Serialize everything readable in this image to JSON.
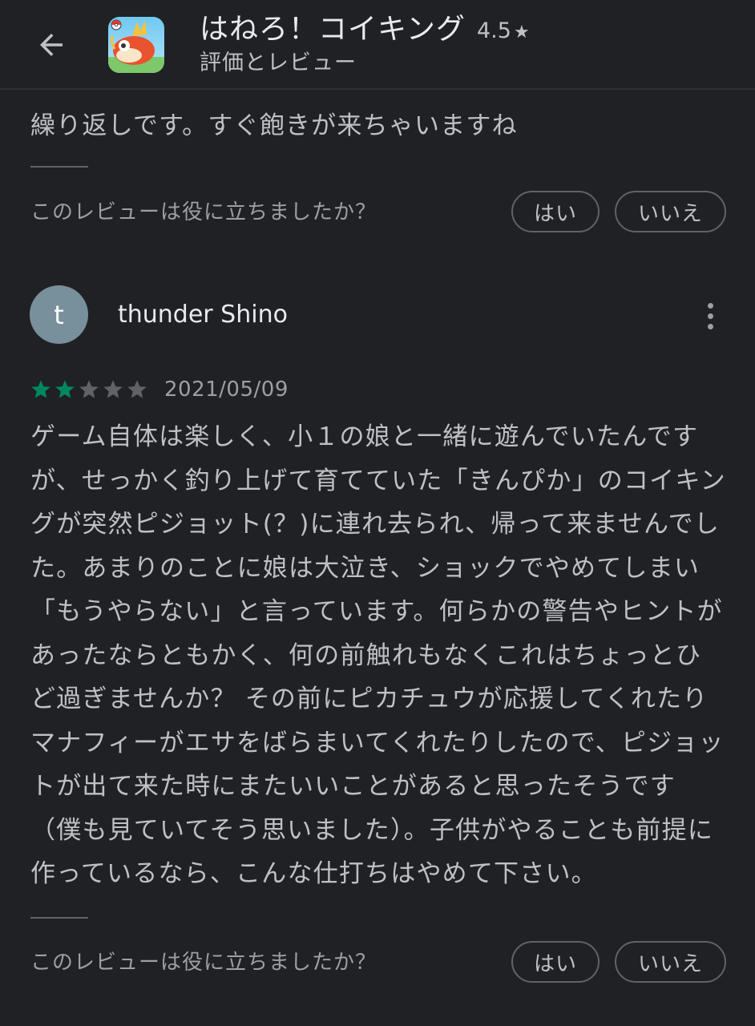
{
  "header": {
    "app_title": "はねろ！コイキング",
    "rating_value": "4.5",
    "rating_star": "★",
    "subtitle": "評価とレビュー",
    "back_icon": "arrow-back-icon"
  },
  "previous_review": {
    "text_tail": "繰り返しです。すぐ飽きが来ちゃいますね",
    "helpful_question": "このレビューは役に立ちましたか？",
    "yes_label": "はい",
    "no_label": "いいえ"
  },
  "review": {
    "avatar_letter": "t",
    "reviewer_name": "thunder Shino",
    "rating": 2,
    "max_rating": 5,
    "date": "2021/05/09",
    "text": "ゲーム自体は楽しく、小１の娘と一緒に遊んでいたんですが、せっかく釣り上げて育てていた「きんぴか」のコイキングが突然ピジョット(？)に連れ去られ、帰って来ませんでした。あまりのことに娘は大泣き、ショックでやめてしまい「もうやらない」と言っています。何らかの警告やヒントがあったならともかく、何の前触れもなくこれはちょっとひど過ぎませんか？ その前にピカチュウが応援してくれたりマナフィーがエサをばらまいてくれたりしたので、ピジョットが出て来た時にまたいいことがあると思ったそうです（僕も見ていてそう思いました）。子供がやることも前提に作っているなら、こんな仕打ちはやめて下さい。",
    "helpful_question": "このレビューは役に立ちましたか？",
    "yes_label": "はい",
    "no_label": "いいえ",
    "more_icon": "more-vert-icon"
  },
  "colors": {
    "background": "#202124",
    "star_filled": "#01875f",
    "star_empty": "#5f6368",
    "avatar_bg": "#78909c"
  }
}
